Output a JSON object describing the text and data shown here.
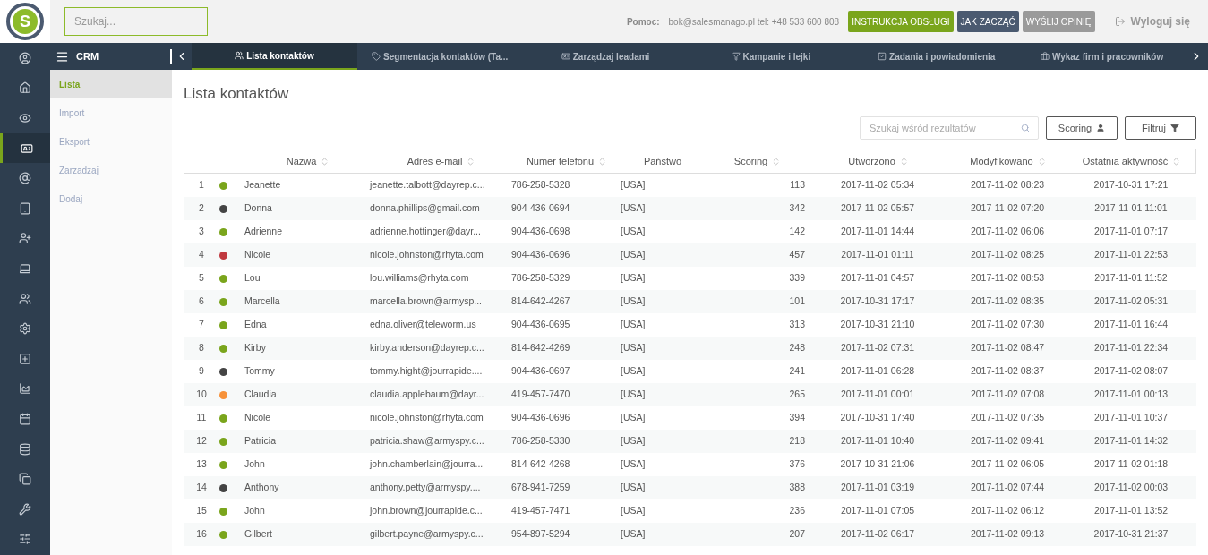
{
  "top_bar": {
    "search": {
      "placeholder": "Szukaj..."
    },
    "help_label": "Pomoc:",
    "help_contact": "bok@salesmanago.pl tel: +48 533 600 808",
    "buttons": [
      {
        "label": "INSTRUKCJA OBSŁUGI",
        "kind": "green"
      },
      {
        "label": "JAK ZACZĄĆ",
        "kind": "slate"
      },
      {
        "label": "WYŚLIJ OPINIĘ",
        "kind": "gray"
      }
    ],
    "logout": "Wyloguj się"
  },
  "logo": {
    "letter": "S"
  },
  "icon_rail": [
    {
      "selected": false
    },
    {
      "selected": false
    },
    {
      "selected": false
    },
    {
      "selected": true
    },
    {
      "selected": false
    },
    {
      "selected": false
    },
    {
      "selected": false
    },
    {
      "selected": false
    },
    {
      "selected": false
    },
    {
      "selected": false
    },
    {
      "selected": false
    },
    {
      "selected": false
    },
    {
      "selected": false
    },
    {
      "selected": false
    },
    {
      "selected": false
    },
    {
      "selected": false
    },
    {
      "selected": false
    }
  ],
  "module": {
    "title": "CRM"
  },
  "tabs": [
    {
      "label": "Lista kontaktów",
      "selected": true
    },
    {
      "label": "Segmentacja kontaktów (Ta...",
      "selected": false
    },
    {
      "label": "Zarządzaj leadami",
      "selected": false
    },
    {
      "label": "Kampanie i lejki",
      "selected": false
    },
    {
      "label": "Zadania i powiadomienia",
      "selected": false
    },
    {
      "label": "Wykaz firm i pracowników",
      "selected": false
    }
  ],
  "sidebar": {
    "items": [
      {
        "label": "Lista",
        "selected": true
      },
      {
        "label": "Import",
        "selected": false
      },
      {
        "label": "Eksport",
        "selected": false
      },
      {
        "label": "Zarządzaj",
        "selected": false
      },
      {
        "label": "Dodaj",
        "selected": false
      }
    ]
  },
  "page_title": "Lista kontaktów",
  "toolbar": {
    "search": {
      "placeholder": "Szukaj wśród rezultatów"
    },
    "scoring_button": "Scoring",
    "filter_button": "Filtruj"
  },
  "table": {
    "columns": [
      {
        "label": "Nazwa",
        "sortable": true
      },
      {
        "label": "Adres e-mail",
        "sortable": true
      },
      {
        "label": "Numer telefonu",
        "sortable": true
      },
      {
        "label": "Państwo",
        "sortable": false
      },
      {
        "label": "Scoring",
        "sortable": true
      },
      {
        "label": "Utworzono",
        "sortable": true
      },
      {
        "label": "Modyfikowano",
        "sortable": true
      },
      {
        "label": "Ostatnia aktywność",
        "sortable": true
      }
    ],
    "rows": [
      {
        "index": "1",
        "color": "#7aa51c",
        "name": "Jeanette",
        "email": "jeanette.talbott@dayrep.c...",
        "phone": "786-258-5328",
        "country": "[USA]",
        "scoring": "113",
        "created": "2017-11-02 05:34",
        "modified": "2017-11-02 08:23",
        "last_activity": "2017-10-31 17:21"
      },
      {
        "index": "2",
        "color": "#444444",
        "name": "Donna",
        "email": "donna.phillips@gmail.com",
        "phone": "904-436-0694",
        "country": "[USA]",
        "scoring": "342",
        "created": "2017-11-02 05:57",
        "modified": "2017-11-02 07:20",
        "last_activity": "2017-11-01 11:01"
      },
      {
        "index": "3",
        "color": "#7aa51c",
        "name": "Adrienne",
        "email": "adrienne.hottinger@dayr...",
        "phone": "904-436-0698",
        "country": "[USA]",
        "scoring": "142",
        "created": "2017-11-01 14:44",
        "modified": "2017-11-02 06:06",
        "last_activity": "2017-11-01 07:17"
      },
      {
        "index": "4",
        "color": "#c0393f",
        "name": "Nicole",
        "email": "nicole.johnston@rhyta.com",
        "phone": "904-436-0696",
        "country": "[USA]",
        "scoring": "457",
        "created": "2017-11-01 01:11",
        "modified": "2017-11-02 08:25",
        "last_activity": "2017-11-01 22:53"
      },
      {
        "index": "5",
        "color": "#7aa51c",
        "name": "Lou",
        "email": "lou.williams@rhyta.com",
        "phone": "786-258-5329",
        "country": "[USA]",
        "scoring": "339",
        "created": "2017-11-01 04:57",
        "modified": "2017-11-02 08:53",
        "last_activity": "2017-11-01 11:52"
      },
      {
        "index": "6",
        "color": "#7aa51c",
        "name": "Marcella",
        "email": "marcella.brown@armysp...",
        "phone": "814-642-4267",
        "country": "[USA]",
        "scoring": "101",
        "created": "2017-10-31 17:17",
        "modified": "2017-11-02 08:35",
        "last_activity": "2017-11-02 05:31"
      },
      {
        "index": "7",
        "color": "#7aa51c",
        "name": "Edna",
        "email": "edna.oliver@teleworm.us",
        "phone": "904-436-0695",
        "country": "[USA]",
        "scoring": "313",
        "created": "2017-10-31 21:10",
        "modified": "2017-11-02 07:30",
        "last_activity": "2017-11-01 16:44"
      },
      {
        "index": "8",
        "color": "#7aa51c",
        "name": "Kirby",
        "email": "kirby.anderson@dayrep.c...",
        "phone": "814-642-4269",
        "country": "[USA]",
        "scoring": "248",
        "created": "2017-11-02 07:31",
        "modified": "2017-11-02 08:47",
        "last_activity": "2017-11-01 22:34"
      },
      {
        "index": "9",
        "color": "#444444",
        "name": "Tommy",
        "email": "tommy.hight@jourrapide....",
        "phone": "904-436-0697",
        "country": "[USA]",
        "scoring": "241",
        "created": "2017-11-01 06:28",
        "modified": "2017-11-02 08:37",
        "last_activity": "2017-11-02 08:07"
      },
      {
        "index": "10",
        "color": "#f7923a",
        "name": "Claudia",
        "email": "claudia.applebaum@dayr...",
        "phone": "419-457-7470",
        "country": "[USA]",
        "scoring": "265",
        "created": "2017-11-01 00:01",
        "modified": "2017-11-02 07:08",
        "last_activity": "2017-11-01 00:13"
      },
      {
        "index": "11",
        "color": "#7aa51c",
        "name": "Nicole",
        "email": "nicole.johnston@rhyta.com",
        "phone": "904-436-0696",
        "country": "[USA]",
        "scoring": "394",
        "created": "2017-10-31 17:40",
        "modified": "2017-11-02 07:35",
        "last_activity": "2017-11-01 10:37"
      },
      {
        "index": "12",
        "color": "#7aa51c",
        "name": "Patricia",
        "email": "patricia.shaw@armyspy.c...",
        "phone": "786-258-5330",
        "country": "[USA]",
        "scoring": "218",
        "created": "2017-11-01 10:40",
        "modified": "2017-11-02 09:41",
        "last_activity": "2017-11-01 14:32"
      },
      {
        "index": "13",
        "color": "#7aa51c",
        "name": "John",
        "email": "john.chamberlain@jourra...",
        "phone": "814-642-4268",
        "country": "[USA]",
        "scoring": "376",
        "created": "2017-10-31 21:06",
        "modified": "2017-11-02 06:05",
        "last_activity": "2017-11-02 01:18"
      },
      {
        "index": "14",
        "color": "#444444",
        "name": "Anthony",
        "email": "anthony.petty@armyspy....",
        "phone": "678-941-7259",
        "country": "[USA]",
        "scoring": "388",
        "created": "2017-11-01 03:19",
        "modified": "2017-11-02 07:44",
        "last_activity": "2017-11-02 00:03"
      },
      {
        "index": "15",
        "color": "#7aa51c",
        "name": "John",
        "email": "john.brown@jourrapide.c...",
        "phone": "419-457-7471",
        "country": "[USA]",
        "scoring": "236",
        "created": "2017-11-01 07:05",
        "modified": "2017-11-02 06:12",
        "last_activity": "2017-11-01 13:52"
      },
      {
        "index": "16",
        "color": "#7aa51c",
        "name": "Gilbert",
        "email": "gilbert.payne@armyspy.c...",
        "phone": "954-897-5294",
        "country": "[USA]",
        "scoring": "207",
        "created": "2017-11-02 06:17",
        "modified": "2017-11-02 09:13",
        "last_activity": "2017-10-31 21:37"
      }
    ]
  }
}
